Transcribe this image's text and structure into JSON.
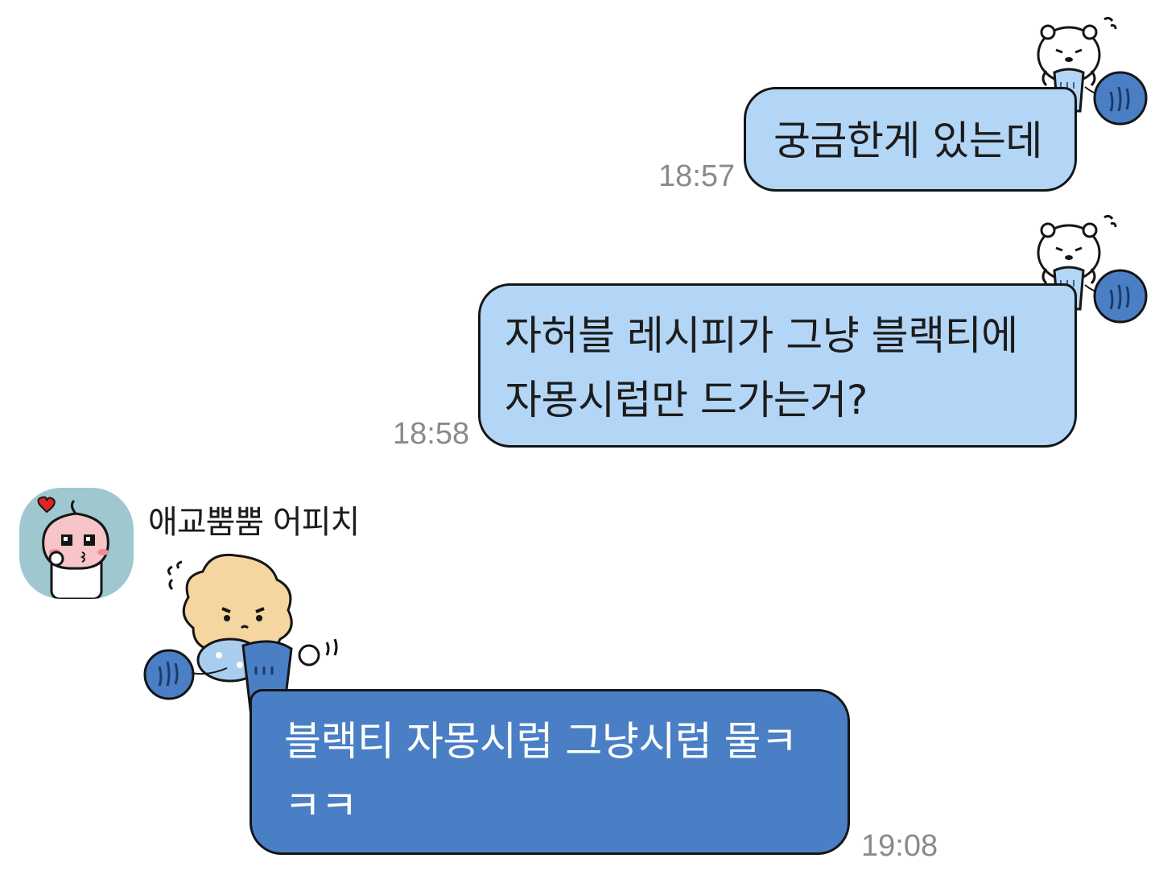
{
  "chat": {
    "messages": [
      {
        "direction": "outgoing",
        "text": "궁금한게 있는데",
        "time": "18:57",
        "sticker": "bear-knitting-icon"
      },
      {
        "direction": "outgoing",
        "text": "자허블 레시피가 그냥 블랙티에\n자몽시럽만 드가는거?",
        "time": "18:58",
        "sticker": "bear-knitting-icon"
      },
      {
        "direction": "incoming",
        "sender": "애교뿜뿜 어피치",
        "text": "블랙티 자몽시럽 그냥시럽 물ㅋ\nㅋㅋ",
        "time": "19:08",
        "sticker": "fluffy-bear-knitting-icon",
        "avatar": "apeach-avatar-icon"
      }
    ]
  },
  "colors": {
    "outgoing_bubble": "#b3d6f6",
    "incoming_bubble": "#4a7fc6",
    "timestamp": "#8a8a8a",
    "avatar_bg": "#9fc7cf"
  }
}
